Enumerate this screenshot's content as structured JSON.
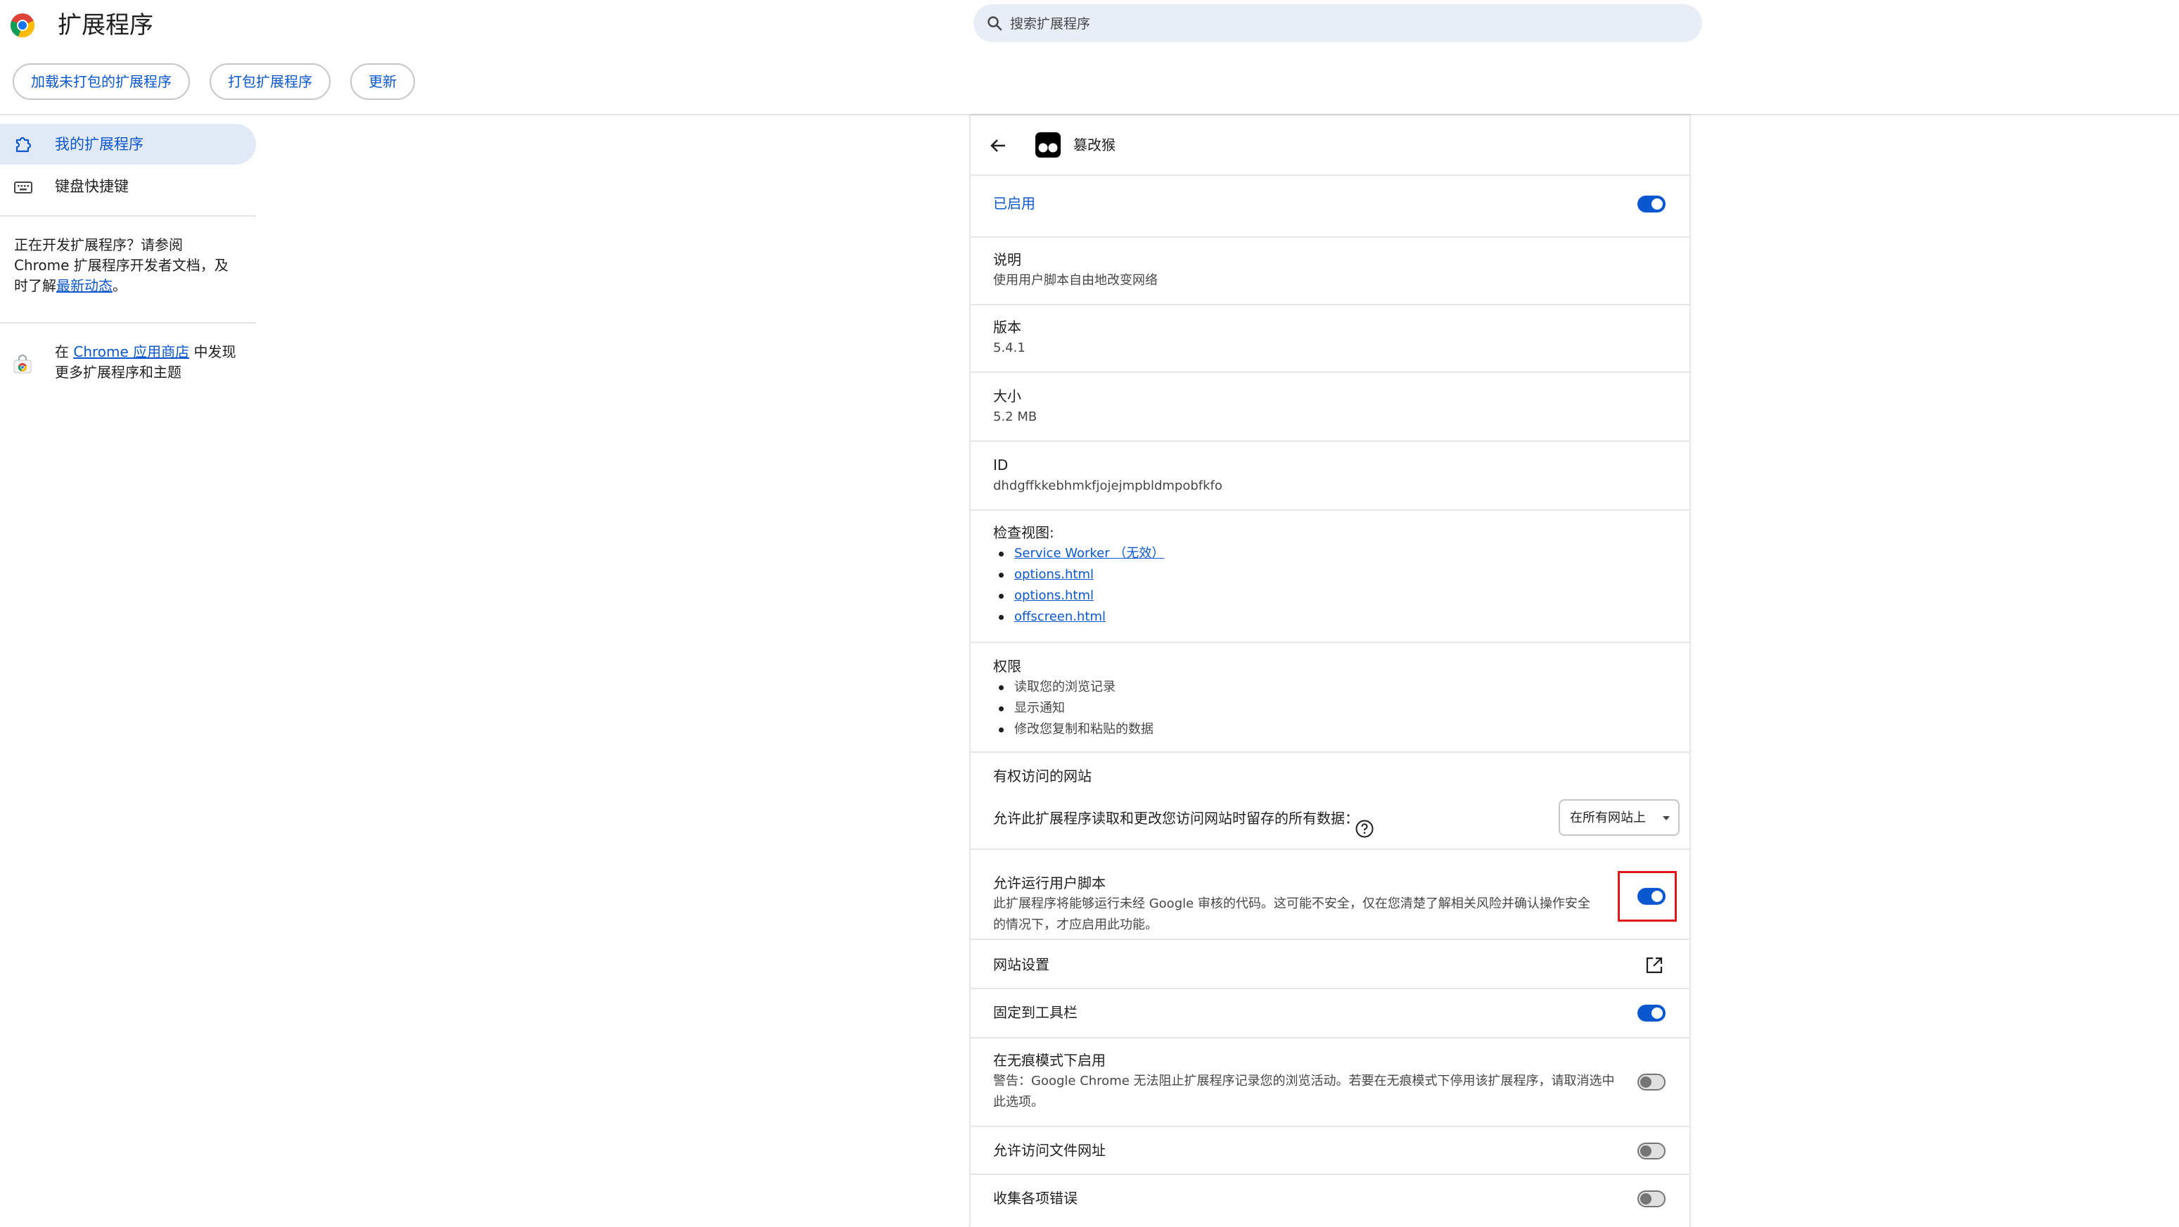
{
  "header": {
    "title": "扩展程序",
    "search_placeholder": "搜索扩展程序",
    "buttons": {
      "load_unpacked": "加载未打包的扩展程序",
      "pack": "打包扩展程序",
      "update": "更新"
    }
  },
  "sidebar": {
    "items": [
      {
        "label": "我的扩展程序",
        "icon": "puzzle-icon",
        "active": true
      },
      {
        "label": "键盘快捷键",
        "icon": "keyboard-icon",
        "active": false
      }
    ],
    "dev_note": {
      "text_before": "正在开发扩展程序？请参阅 Chrome 扩展程序开发者文档，及时了解",
      "link": "最新动态",
      "text_after": "。"
    },
    "store_note": {
      "text_before": "在 ",
      "link": "Chrome 应用商店",
      "text_after": " 中发现更多扩展程序和主题"
    }
  },
  "detail": {
    "extension_name": "篡改猴",
    "enabled_label": "已启用",
    "description_label": "说明",
    "description": "使用用户脚本自由地改变网络",
    "version_label": "版本",
    "version": "5.4.1",
    "size_label": "大小",
    "size": "5.2 MB",
    "id_label": "ID",
    "id": "dhdgffkkebhmkfjojejmpbldmpobfkfo",
    "inspect_label": "检查视图:",
    "inspect_views": [
      "Service Worker （无效）",
      "options.html",
      "options.html",
      "offscreen.html"
    ],
    "permissions_label": "权限",
    "permissions": [
      "读取您的浏览记录",
      "显示通知",
      "修改您复制和粘贴的数据"
    ],
    "site_access_label": "有权访问的网站",
    "site_access_desc": "允许此扩展程序读取和更改您访问网站时留存的所有数据：",
    "site_access_value": "在所有网站上",
    "user_scripts_label": "允许运行用户脚本",
    "user_scripts_desc": "此扩展程序将能够运行未经 Google 审核的代码。这可能不安全，仅在您清楚了解相关风险并确认操作安全的情况下，才应启用此功能。",
    "site_settings_label": "网站设置",
    "pin_label": "固定到工具栏",
    "incognito_label": "在无痕模式下启用",
    "incognito_desc": "警告：Google Chrome 无法阻止扩展程序记录您的浏览活动。若要在无痕模式下停用该扩展程序，请取消选中此选项。",
    "file_urls_label": "允许访问文件网址",
    "errors_label": "收集各项错误",
    "toggles": {
      "enabled": true,
      "user_scripts": true,
      "pin": true,
      "incognito": false,
      "file_urls": false,
      "errors": false
    }
  },
  "colors": {
    "accent": "#0b57d0",
    "highlight": "#e3161c"
  }
}
